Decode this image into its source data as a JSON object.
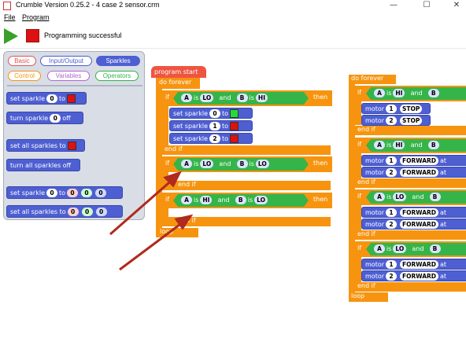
{
  "window": {
    "title": "Crumble Version 0.25.2 - 4 case 2 sensor.crm",
    "minimize": "—",
    "maximize": "☐",
    "close": "✕"
  },
  "menu": {
    "file": "File",
    "program": "Program"
  },
  "toolbar": {
    "status": "Programming successful"
  },
  "palette": {
    "tabs": [
      "Basic",
      "Input/Output",
      "Sparkles",
      "Control",
      "Variables",
      "Operators"
    ],
    "tab_colors": [
      "#e05555",
      "#4e5fd2",
      "#4e5fd2",
      "#f7940f",
      "#b565d6",
      "#35b44a"
    ],
    "blocks": {
      "set_sparkle": "set sparkle",
      "to": "to",
      "turn_sparkle": "turn sparkle",
      "off": "off",
      "set_all_sparkles_to": "set all sparkles to",
      "turn_all_sparkles_off": "turn all sparkles off",
      "zero": "0"
    }
  },
  "program": {
    "start": "program start",
    "do_forever": "do forever",
    "if": "if",
    "then": "then",
    "end_if": "end if",
    "loop": "loop",
    "and": "and",
    "is": "is",
    "A": "A",
    "B": "B",
    "HI": "HI",
    "LO": "LO",
    "set_sparkle": "set sparkle",
    "to": "to",
    "n0": "0",
    "n1": "1",
    "n2": "2",
    "motor": "motor",
    "stop": "STOP",
    "forward": "FORWARD",
    "at": "at"
  },
  "colors": {
    "block_blue": "#4e5fd2",
    "control_orange": "#f7940f",
    "operator_green": "#35b44a",
    "arrow_red": "#b02a1e"
  }
}
